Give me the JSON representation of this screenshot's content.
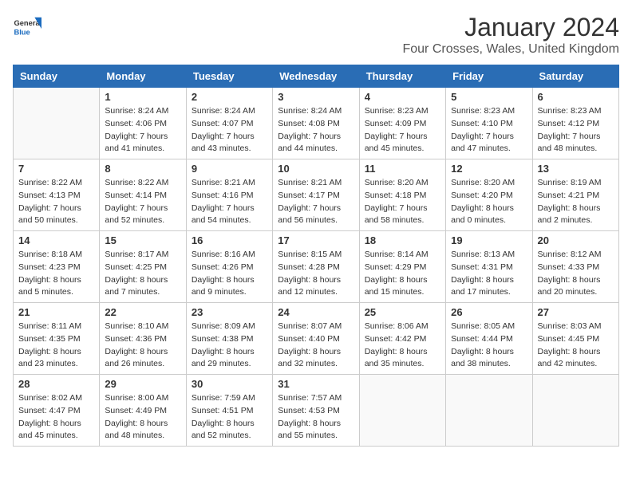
{
  "header": {
    "logo_line1": "General",
    "logo_line2": "Blue",
    "month_title": "January 2024",
    "location": "Four Crosses, Wales, United Kingdom"
  },
  "weekdays": [
    "Sunday",
    "Monday",
    "Tuesday",
    "Wednesday",
    "Thursday",
    "Friday",
    "Saturday"
  ],
  "weeks": [
    [
      {
        "day": "",
        "sunrise": "",
        "sunset": "",
        "daylight": ""
      },
      {
        "day": "1",
        "sunrise": "Sunrise: 8:24 AM",
        "sunset": "Sunset: 4:06 PM",
        "daylight": "Daylight: 7 hours and 41 minutes."
      },
      {
        "day": "2",
        "sunrise": "Sunrise: 8:24 AM",
        "sunset": "Sunset: 4:07 PM",
        "daylight": "Daylight: 7 hours and 43 minutes."
      },
      {
        "day": "3",
        "sunrise": "Sunrise: 8:24 AM",
        "sunset": "Sunset: 4:08 PM",
        "daylight": "Daylight: 7 hours and 44 minutes."
      },
      {
        "day": "4",
        "sunrise": "Sunrise: 8:23 AM",
        "sunset": "Sunset: 4:09 PM",
        "daylight": "Daylight: 7 hours and 45 minutes."
      },
      {
        "day": "5",
        "sunrise": "Sunrise: 8:23 AM",
        "sunset": "Sunset: 4:10 PM",
        "daylight": "Daylight: 7 hours and 47 minutes."
      },
      {
        "day": "6",
        "sunrise": "Sunrise: 8:23 AM",
        "sunset": "Sunset: 4:12 PM",
        "daylight": "Daylight: 7 hours and 48 minutes."
      }
    ],
    [
      {
        "day": "7",
        "sunrise": "Sunrise: 8:22 AM",
        "sunset": "Sunset: 4:13 PM",
        "daylight": "Daylight: 7 hours and 50 minutes."
      },
      {
        "day": "8",
        "sunrise": "Sunrise: 8:22 AM",
        "sunset": "Sunset: 4:14 PM",
        "daylight": "Daylight: 7 hours and 52 minutes."
      },
      {
        "day": "9",
        "sunrise": "Sunrise: 8:21 AM",
        "sunset": "Sunset: 4:16 PM",
        "daylight": "Daylight: 7 hours and 54 minutes."
      },
      {
        "day": "10",
        "sunrise": "Sunrise: 8:21 AM",
        "sunset": "Sunset: 4:17 PM",
        "daylight": "Daylight: 7 hours and 56 minutes."
      },
      {
        "day": "11",
        "sunrise": "Sunrise: 8:20 AM",
        "sunset": "Sunset: 4:18 PM",
        "daylight": "Daylight: 7 hours and 58 minutes."
      },
      {
        "day": "12",
        "sunrise": "Sunrise: 8:20 AM",
        "sunset": "Sunset: 4:20 PM",
        "daylight": "Daylight: 8 hours and 0 minutes."
      },
      {
        "day": "13",
        "sunrise": "Sunrise: 8:19 AM",
        "sunset": "Sunset: 4:21 PM",
        "daylight": "Daylight: 8 hours and 2 minutes."
      }
    ],
    [
      {
        "day": "14",
        "sunrise": "Sunrise: 8:18 AM",
        "sunset": "Sunset: 4:23 PM",
        "daylight": "Daylight: 8 hours and 5 minutes."
      },
      {
        "day": "15",
        "sunrise": "Sunrise: 8:17 AM",
        "sunset": "Sunset: 4:25 PM",
        "daylight": "Daylight: 8 hours and 7 minutes."
      },
      {
        "day": "16",
        "sunrise": "Sunrise: 8:16 AM",
        "sunset": "Sunset: 4:26 PM",
        "daylight": "Daylight: 8 hours and 9 minutes."
      },
      {
        "day": "17",
        "sunrise": "Sunrise: 8:15 AM",
        "sunset": "Sunset: 4:28 PM",
        "daylight": "Daylight: 8 hours and 12 minutes."
      },
      {
        "day": "18",
        "sunrise": "Sunrise: 8:14 AM",
        "sunset": "Sunset: 4:29 PM",
        "daylight": "Daylight: 8 hours and 15 minutes."
      },
      {
        "day": "19",
        "sunrise": "Sunrise: 8:13 AM",
        "sunset": "Sunset: 4:31 PM",
        "daylight": "Daylight: 8 hours and 17 minutes."
      },
      {
        "day": "20",
        "sunrise": "Sunrise: 8:12 AM",
        "sunset": "Sunset: 4:33 PM",
        "daylight": "Daylight: 8 hours and 20 minutes."
      }
    ],
    [
      {
        "day": "21",
        "sunrise": "Sunrise: 8:11 AM",
        "sunset": "Sunset: 4:35 PM",
        "daylight": "Daylight: 8 hours and 23 minutes."
      },
      {
        "day": "22",
        "sunrise": "Sunrise: 8:10 AM",
        "sunset": "Sunset: 4:36 PM",
        "daylight": "Daylight: 8 hours and 26 minutes."
      },
      {
        "day": "23",
        "sunrise": "Sunrise: 8:09 AM",
        "sunset": "Sunset: 4:38 PM",
        "daylight": "Daylight: 8 hours and 29 minutes."
      },
      {
        "day": "24",
        "sunrise": "Sunrise: 8:07 AM",
        "sunset": "Sunset: 4:40 PM",
        "daylight": "Daylight: 8 hours and 32 minutes."
      },
      {
        "day": "25",
        "sunrise": "Sunrise: 8:06 AM",
        "sunset": "Sunset: 4:42 PM",
        "daylight": "Daylight: 8 hours and 35 minutes."
      },
      {
        "day": "26",
        "sunrise": "Sunrise: 8:05 AM",
        "sunset": "Sunset: 4:44 PM",
        "daylight": "Daylight: 8 hours and 38 minutes."
      },
      {
        "day": "27",
        "sunrise": "Sunrise: 8:03 AM",
        "sunset": "Sunset: 4:45 PM",
        "daylight": "Daylight: 8 hours and 42 minutes."
      }
    ],
    [
      {
        "day": "28",
        "sunrise": "Sunrise: 8:02 AM",
        "sunset": "Sunset: 4:47 PM",
        "daylight": "Daylight: 8 hours and 45 minutes."
      },
      {
        "day": "29",
        "sunrise": "Sunrise: 8:00 AM",
        "sunset": "Sunset: 4:49 PM",
        "daylight": "Daylight: 8 hours and 48 minutes."
      },
      {
        "day": "30",
        "sunrise": "Sunrise: 7:59 AM",
        "sunset": "Sunset: 4:51 PM",
        "daylight": "Daylight: 8 hours and 52 minutes."
      },
      {
        "day": "31",
        "sunrise": "Sunrise: 7:57 AM",
        "sunset": "Sunset: 4:53 PM",
        "daylight": "Daylight: 8 hours and 55 minutes."
      },
      {
        "day": "",
        "sunrise": "",
        "sunset": "",
        "daylight": ""
      },
      {
        "day": "",
        "sunrise": "",
        "sunset": "",
        "daylight": ""
      },
      {
        "day": "",
        "sunrise": "",
        "sunset": "",
        "daylight": ""
      }
    ]
  ]
}
